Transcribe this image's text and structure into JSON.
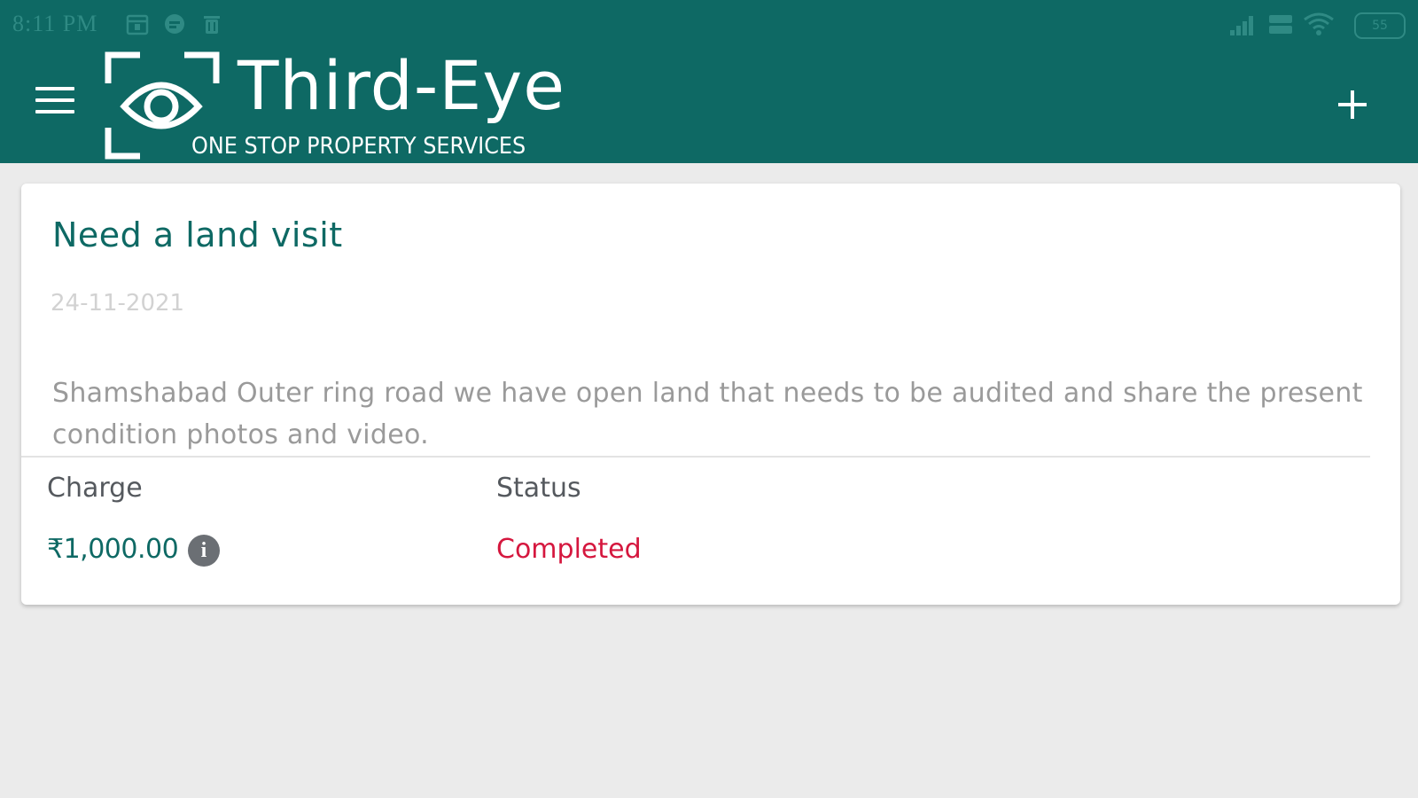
{
  "statusbar": {
    "time": "8:11 PM",
    "battery": "55"
  },
  "appbar": {
    "logo_title": "Third-Eye",
    "logo_tagline": "ONE STOP PROPERTY SERVICES"
  },
  "request": {
    "title": "Need a land visit",
    "date": "24-11-2021",
    "description": "Shamshabad Outer ring road we have open land that needs to be audited and share the present condition photos and video.",
    "charge_label": "Charge",
    "charge_value": "₹1,000.00",
    "status_label": "Status",
    "status_value": "Completed"
  },
  "colors": {
    "primary": "#0e6964",
    "status_completed": "#d5173e",
    "background": "#ebebeb"
  },
  "icons": [
    "menu-icon",
    "eye-icon",
    "add-icon",
    "info-icon",
    "signal-icon",
    "wifi-icon",
    "battery-icon"
  ]
}
